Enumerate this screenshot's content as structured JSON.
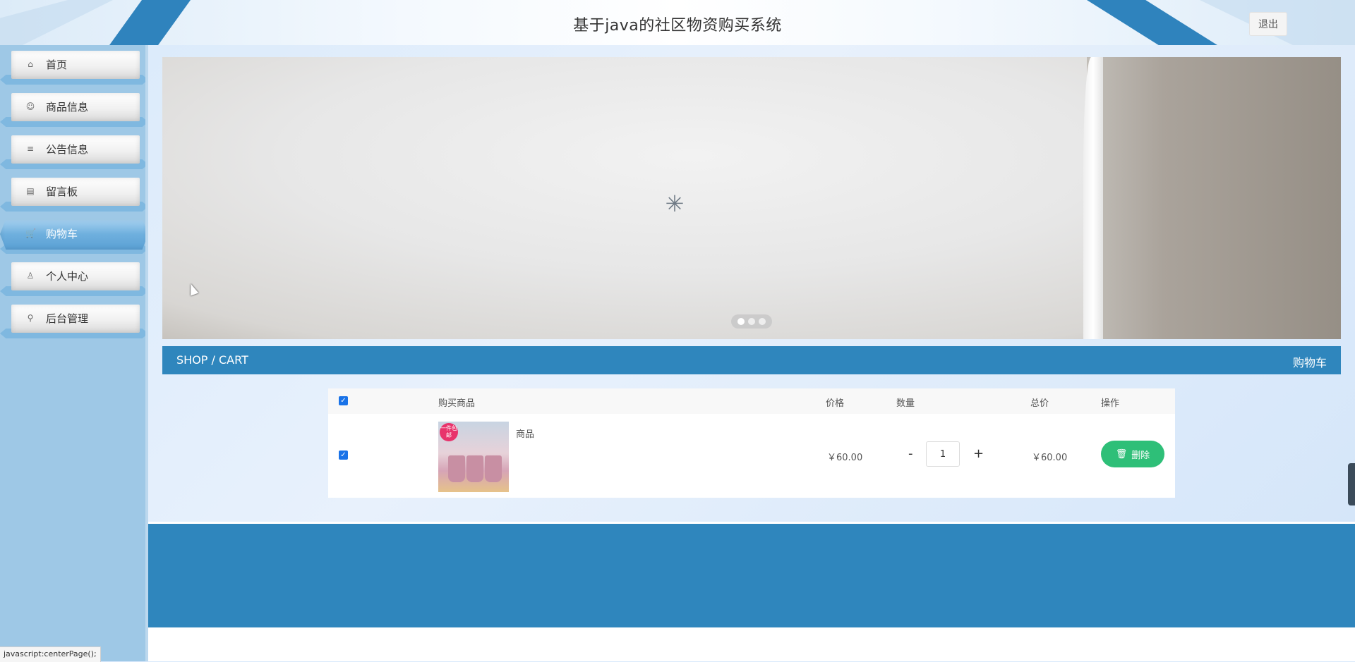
{
  "header": {
    "title": "基于java的社区物资购买系统",
    "logout_label": "退出"
  },
  "sidebar": {
    "items": [
      {
        "label": "首页",
        "icon": "home-icon",
        "glyph": "⌂"
      },
      {
        "label": "商品信息",
        "icon": "goods-icon",
        "glyph": "☺"
      },
      {
        "label": "公告信息",
        "icon": "sliders-icon",
        "glyph": "≡"
      },
      {
        "label": "留言板",
        "icon": "calendar-icon",
        "glyph": "▤"
      },
      {
        "label": "购物车",
        "icon": "cart-icon",
        "glyph": "🛒",
        "active": true
      },
      {
        "label": "个人中心",
        "icon": "user-icon",
        "glyph": "♙"
      },
      {
        "label": "后台管理",
        "icon": "link-icon",
        "glyph": "⚲"
      }
    ]
  },
  "carousel": {
    "spinner_glyph": "✳",
    "dot_count": 3,
    "active_dot": 0
  },
  "section": {
    "left_text": "SHOP / CART",
    "right_text": "购物车"
  },
  "cart": {
    "headers": {
      "product": "购买商品",
      "price": "价格",
      "quantity": "数量",
      "total": "总价",
      "action": "操作"
    },
    "select_all_checked": true,
    "rows": [
      {
        "checked": true,
        "name": "商品",
        "badge_text": "一件包邮",
        "price": "￥60.00",
        "quantity": "1",
        "total": "￥60.00",
        "delete_label": "删除"
      }
    ],
    "minus_label": "-",
    "plus_label": "+"
  },
  "status_bar": {
    "text": "javascript:centerPage();"
  },
  "colors": {
    "header_accent": "#2f83bd",
    "section_bar": "#2f86bd",
    "footer": "#2f86bd",
    "delete_button": "#2ebf78",
    "sidebar_bg": "#9ec8e6",
    "checkbox": "#1a73e8"
  }
}
